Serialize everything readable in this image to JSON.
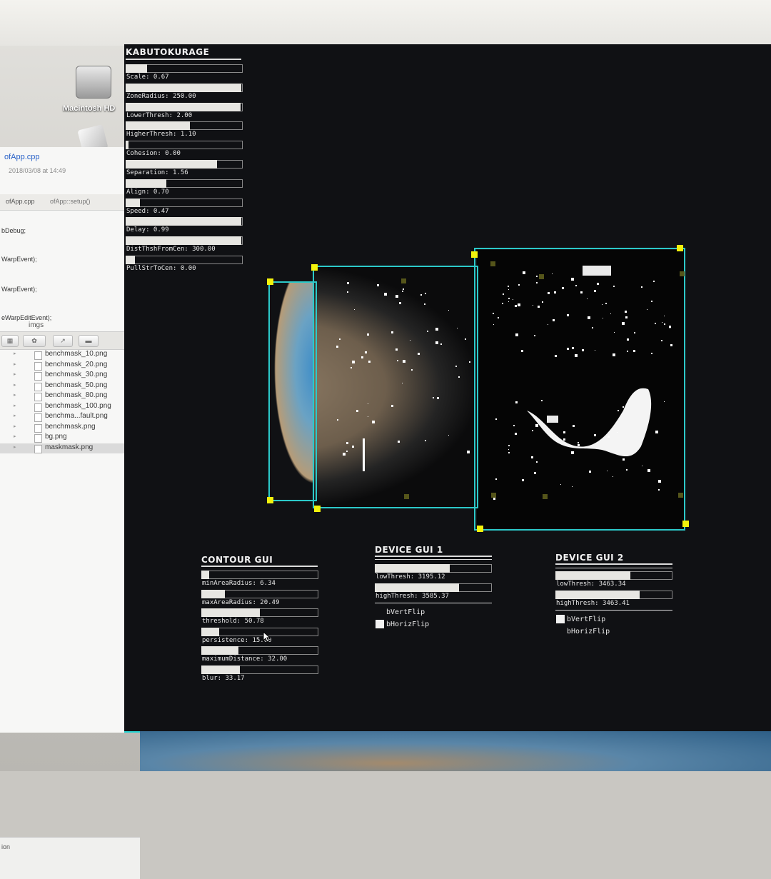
{
  "desktop": {
    "drive_label": "Macintosh HD",
    "icons": {
      "drive": "hard-drive-icon",
      "app": "app-icon"
    }
  },
  "finder": {
    "file_title": "ofApp.cpp",
    "file_date": "2018/03/08 at 14:49",
    "tabs": [
      "ofApp.cpp",
      "ofApp::setup()"
    ],
    "code_lines": [
      "bDebug;",
      "WarpEvent);",
      "WarpEvent);",
      "eWarpEditEvent);"
    ],
    "folder": "imgs",
    "files": [
      "benchmask_10.png",
      "benchmask_20.png",
      "benchmask_30.png",
      "benchmask_50.png",
      "benchmask_80.png",
      "benchmask_100.png",
      "benchma...fault.png",
      "benchmask.png",
      "bg.png",
      "maskmask.png"
    ],
    "selected_file": "maskmask.png",
    "status_text": "ion"
  },
  "kabuto_gui": {
    "title": "KABUTOKURAGE",
    "params": [
      {
        "label": "Scale: 0.67",
        "fill": 0.18
      },
      {
        "label": "ZoneRadius: 250.00",
        "fill": 0.99
      },
      {
        "label": "LowerThresh: 2.00",
        "fill": 0.98
      },
      {
        "label": "HigherThresh: 1.10",
        "fill": 0.55
      },
      {
        "label": "Cohesion: 0.00",
        "fill": 0.0
      },
      {
        "label": "Separation: 1.56",
        "fill": 0.78
      },
      {
        "label": "Align: 0.70",
        "fill": 0.35
      },
      {
        "label": "Speed: 0.47",
        "fill": 0.12
      },
      {
        "label": "Delay: 0.99",
        "fill": 0.99
      },
      {
        "label": "DistThshFromCen: 300.00",
        "fill": 0.99
      },
      {
        "label": "PullStrToCen: 0.00",
        "fill": 0.08
      }
    ]
  },
  "contour_gui": {
    "title": "CONTOUR GUI",
    "params": [
      {
        "label": "minAreaRadius: 6.34",
        "fill": 0.07
      },
      {
        "label": "maxAreaRadius: 20.49",
        "fill": 0.2
      },
      {
        "label": "threshold: 50.78",
        "fill": 0.5
      },
      {
        "label": "persistence: 15.00",
        "fill": 0.15
      },
      {
        "label": "maximumDistance: 32.00",
        "fill": 0.32
      },
      {
        "label": "blur: 33.17",
        "fill": 0.33
      }
    ]
  },
  "device_gui_1": {
    "title": "DEVICE GUI 1",
    "params": [
      {
        "label": "lowThresh: 3195.12",
        "fill": 0.64
      },
      {
        "label": "highThresh: 3585.37",
        "fill": 0.72
      }
    ],
    "toggles": [
      {
        "label": "bVertFlip",
        "checked": false
      },
      {
        "label": "bHorizFlip",
        "checked": true
      }
    ]
  },
  "device_gui_2": {
    "title": "DEVICE GUI 2",
    "params": [
      {
        "label": "lowThresh: 3463.34",
        "fill": 0.64
      },
      {
        "label": "highThresh: 3463.41",
        "fill": 0.72
      }
    ],
    "toggles": [
      {
        "label": "bVertFlip",
        "checked": true
      },
      {
        "label": "bHorizFlip",
        "checked": false
      }
    ]
  },
  "colors": {
    "window_bg": "#101114",
    "frame": "#2cc9c9",
    "handle": "#f2f20c",
    "slider_fill": "#e7e6e2",
    "text": "#e8e8e8"
  }
}
